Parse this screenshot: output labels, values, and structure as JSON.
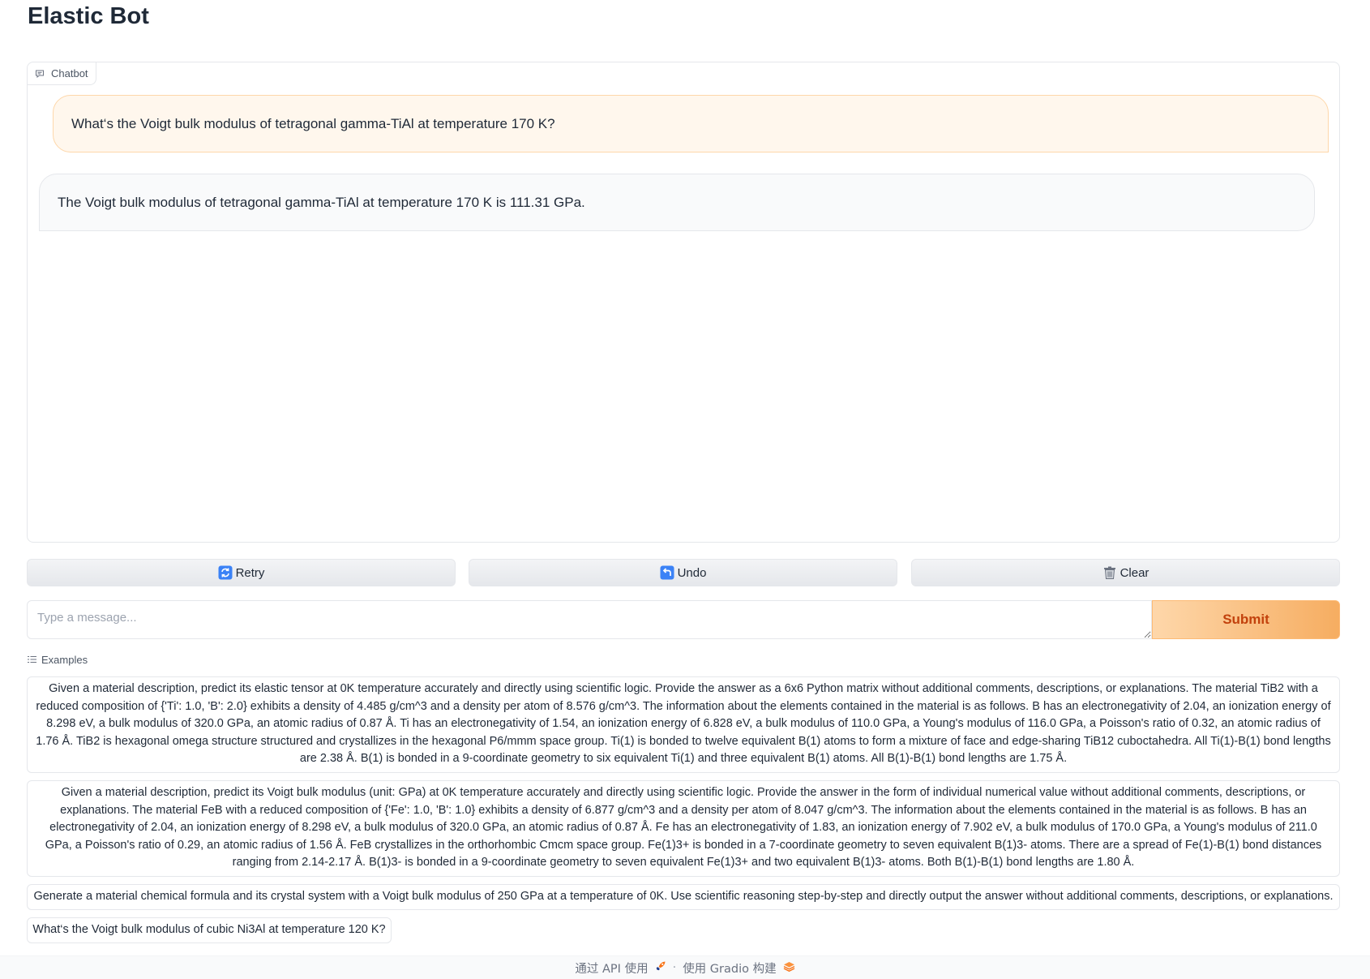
{
  "app": {
    "title": "Elastic Bot"
  },
  "chatbot": {
    "label": "Chatbot",
    "messages": [
      {
        "role": "user",
        "text": "What‘s the Voigt bulk modulus of tetragonal gamma-TiAl at temperature 170 K?"
      },
      {
        "role": "bot",
        "text": "The Voigt bulk modulus of tetragonal gamma-TiAl at temperature 170 K is 111.31 GPa."
      }
    ]
  },
  "actions": {
    "retry_label": "Retry",
    "undo_label": "Undo",
    "clear_label": "Clear"
  },
  "input": {
    "placeholder": "Type a message...",
    "value": "",
    "submit_label": "Submit"
  },
  "examples": {
    "label": "Examples",
    "items": [
      "Given a material description, predict its elastic tensor at 0K temperature accurately and directly using scientific logic. Provide the answer as a 6x6 Python matrix without additional comments, descriptions, or explanations. The material TiB2 with a reduced composition of {'Ti': 1.0, 'B': 2.0} exhibits a density of 4.485 g/cm^3 and a density per atom of 8.576 g/cm^3. The information about the elements contained in the material is as follows. B has an electronegativity of 2.04, an ionization energy of 8.298 eV, a bulk modulus of 320.0 GPa, an atomic radius of 0.87 Å. Ti has an electronegativity of 1.54, an ionization energy of 6.828 eV, a bulk modulus of 110.0 GPa, a Young's modulus of 116.0 GPa, a Poisson's ratio of 0.32, an atomic radius of 1.76 Å. TiB2 is hexagonal omega structure structured and crystallizes in the hexagonal P6/mmm space group. Ti(1) is bonded to twelve equivalent B(1) atoms to form a mixture of face and edge-sharing TiB12 cuboctahedra. All Ti(1)-B(1) bond lengths are 2.38 Å. B(1) is bonded in a 9-coordinate geometry to six equivalent Ti(1) and three equivalent B(1) atoms. All B(1)-B(1) bond lengths are 1.75 Å.",
      "Given a material description, predict its Voigt bulk modulus (unit: GPa) at 0K temperature accurately and directly using scientific logic. Provide the answer in the form of individual numerical value without additional comments, descriptions, or explanations. The material FeB with a reduced composition of {'Fe': 1.0, 'B': 1.0} exhibits a density of 6.877 g/cm^3 and a density per atom of 8.047 g/cm^3. The information about the elements contained in the material is as follows. B has an electronegativity of 2.04, an ionization energy of 8.298 eV, a bulk modulus of 320.0 GPa, an atomic radius of 0.87 Å. Fe has an electronegativity of 1.83, an ionization energy of 7.902 eV, a bulk modulus of 170.0 GPa, a Young's modulus of 211.0 GPa, a Poisson's ratio of 0.29, an atomic radius of 1.56 Å. FeB crystallizes in the orthorhombic Cmcm space group. Fe(1)3+ is bonded in a 7-coordinate geometry to seven equivalent B(1)3- atoms. There are a spread of Fe(1)-B(1) bond distances ranging from 2.14-2.17 Å. B(1)3- is bonded in a 9-coordinate geometry to seven equivalent Fe(1)3+ and two equivalent B(1)3- atoms. Both B(1)-B(1) bond lengths are 1.80 Å.",
      "Generate a material chemical formula and its crystal system with a Voigt bulk modulus of 250 GPa at a temperature of 0K. Use scientific reasoning step-by-step and directly output the answer without additional comments, descriptions, or explanations.",
      "What‘s the Voigt bulk modulus of cubic Ni3Al at temperature 120 K?"
    ]
  },
  "footer": {
    "api_label": "通过 API 使用",
    "separator": "·",
    "built_with_label": "使用 Gradio 构建"
  },
  "colors": {
    "accent": "#f6ad61",
    "submit_text": "#c2410c",
    "user_bubble_bg": "#fff7ed",
    "user_bubble_border": "#fed7aa",
    "bot_bubble_bg": "#f9fafb"
  }
}
